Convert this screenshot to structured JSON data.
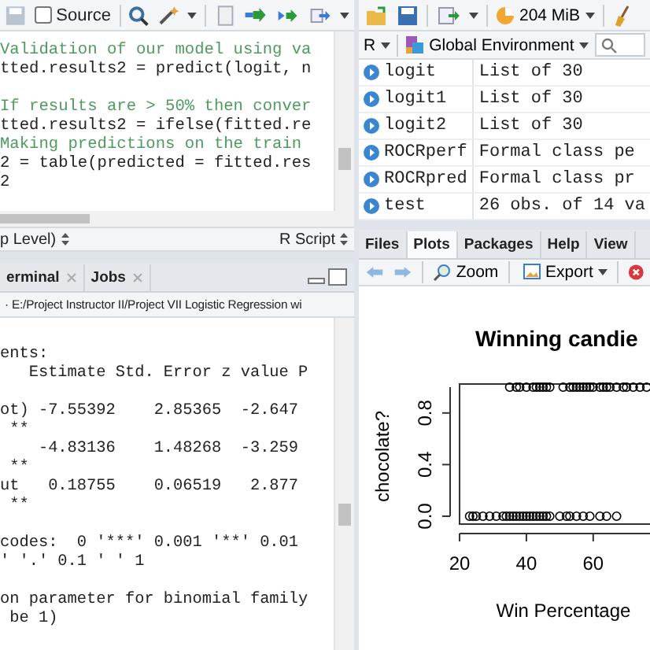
{
  "editor": {
    "source": {
      "label": "Source",
      "checked": false
    },
    "lines": [
      {
        "kind": "comment",
        "text": "Validation of our model using va"
      },
      {
        "kind": "code",
        "text": "tted.results2 = predict(logit, n"
      },
      {
        "kind": "blank"
      },
      {
        "kind": "comment",
        "text": "If results are > 50% then conver"
      },
      {
        "kind": "code",
        "text": "tted.results2 = ifelse(fitted.re"
      },
      {
        "kind": "comment",
        "text": "Making predictions on the train"
      },
      {
        "kind": "code",
        "text": "2 = table(predicted = fitted.res"
      },
      {
        "kind": "code",
        "text": "2"
      }
    ],
    "status": {
      "scope": "p Level)",
      "file_type": "R Script"
    }
  },
  "console": {
    "tabs": [
      {
        "label": "erminal",
        "selected": false
      },
      {
        "label": "Jobs",
        "selected": false
      }
    ],
    "path": "· E:/Project Instructor II/Project VII Logistic Regression wi",
    "lines": [
      {
        "kind": "text",
        "text": "ents:"
      },
      {
        "kind": "text",
        "text": "   Estimate Std. Error z value P"
      },
      {
        "kind": "blank"
      },
      {
        "kind": "text",
        "text": "ot) -7.55392    2.85365  -2.647"
      },
      {
        "kind": "text",
        "text": " **"
      },
      {
        "kind": "text",
        "text": "    -4.83136    1.48268  -3.259"
      },
      {
        "kind": "text",
        "text": " **"
      },
      {
        "kind": "text",
        "text": "ut   0.18755    0.06519   2.877"
      },
      {
        "kind": "text",
        "text": " **"
      },
      {
        "kind": "blank"
      },
      {
        "kind": "text",
        "text": "codes:  0 '***' 0.001 '**' 0.01"
      },
      {
        "kind": "text",
        "text": "' '.' 0.1 ' ' 1"
      },
      {
        "kind": "blank"
      },
      {
        "kind": "text",
        "text": "on parameter for binomial family"
      },
      {
        "kind": "text",
        "text": " be 1)"
      }
    ]
  },
  "environment": {
    "memory": "204 MiB",
    "language": "R",
    "scope": "Global Environment",
    "rows": [
      {
        "name": "logit",
        "value": "List of  30"
      },
      {
        "name": "logit1",
        "value": "List of  30"
      },
      {
        "name": "logit2",
        "value": "List of  30"
      },
      {
        "name": "ROCRperf",
        "value": "Formal class  pe"
      },
      {
        "name": "ROCRpred",
        "value": "Formal class  pr"
      },
      {
        "name": "test",
        "value": "26 obs. of 14 va"
      }
    ]
  },
  "viewer": {
    "tabs": [
      {
        "label": "Files",
        "selected": false
      },
      {
        "label": "Plots",
        "selected": true
      },
      {
        "label": "Packages",
        "selected": false
      },
      {
        "label": "Help",
        "selected": false
      },
      {
        "label": "View",
        "selected": false
      }
    ],
    "zoom": "Zoom",
    "export": "Export",
    "plot": {
      "chart_data": {
        "type": "scatter",
        "title": "Winning candie",
        "xlabel": "Win Percentage",
        "ylabel": "chocolate?",
        "x": [
          35,
          37,
          38,
          40,
          42,
          43,
          44,
          45,
          46,
          47,
          51,
          53,
          54,
          55,
          56,
          57,
          58,
          59,
          60,
          62,
          63,
          64,
          65,
          67,
          69,
          70,
          72,
          74,
          76,
          23,
          24,
          25,
          27,
          29,
          31,
          33,
          34,
          35,
          36,
          37,
          38,
          39,
          40,
          41,
          42,
          43,
          44,
          45,
          46,
          47,
          50,
          52,
          53,
          55,
          57,
          59,
          62,
          64,
          67
        ],
        "series": [
          {
            "color": "#000000",
            "values": [
              1,
              1,
              1,
              1,
              1,
              1,
              1,
              1,
              1,
              1,
              1,
              1,
              1,
              1,
              1,
              1,
              1,
              1,
              1,
              1,
              1,
              1,
              1,
              1,
              1,
              1,
              1,
              1,
              1,
              0,
              0,
              0,
              0,
              0,
              0,
              0,
              0,
              0,
              0,
              0,
              0,
              0,
              0,
              0,
              0,
              0,
              0,
              0,
              0,
              0,
              0,
              0,
              0,
              0,
              0,
              0,
              0,
              0,
              0
            ]
          }
        ],
        "xlim": [
          20,
          77
        ],
        "ylim": [
          0,
          1
        ],
        "xticks": [
          20,
          40,
          60
        ],
        "yticks": [
          {
            "value": 0,
            "label": "0.0"
          },
          {
            "value": 0.4,
            "label": "0.4"
          },
          {
            "value": 0.8,
            "label": "0.8"
          }
        ]
      }
    }
  }
}
